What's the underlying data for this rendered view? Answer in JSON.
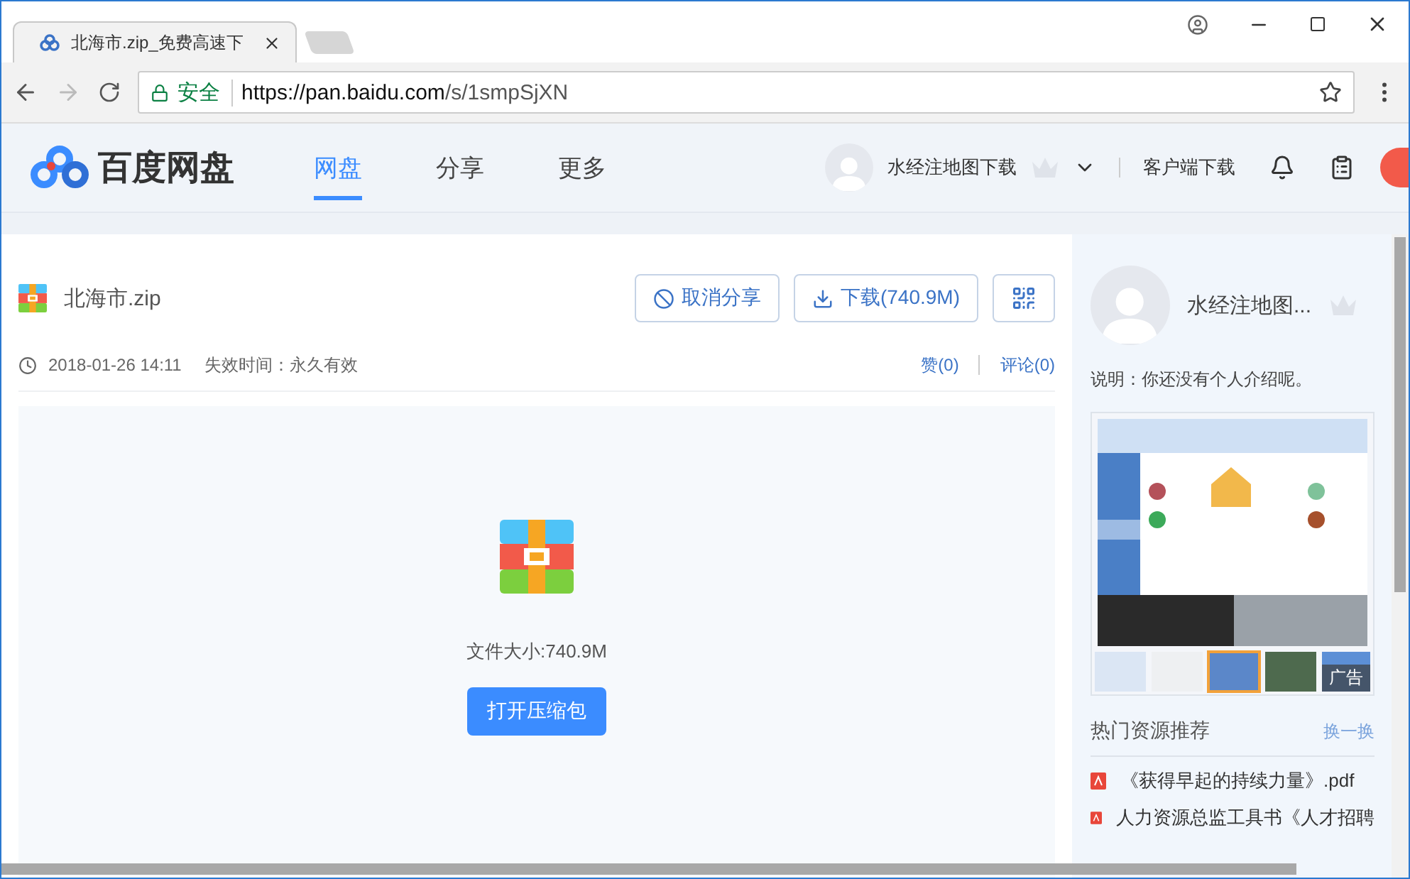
{
  "browser": {
    "tab": {
      "title": "北海市.zip_免费高速下"
    },
    "address": {
      "secure_label": "安全",
      "url_host": "https://pan.baidu.com",
      "url_path": "/s/1smpSjXN"
    }
  },
  "header": {
    "logo": "百度网盘",
    "nav": [
      {
        "label": "网盘",
        "selected": true
      },
      {
        "label": "分享",
        "selected": false
      },
      {
        "label": "更多",
        "selected": false
      }
    ],
    "username": "水经注地图下载",
    "client_download": "客户端下载"
  },
  "file": {
    "name": "北海市.zip",
    "buttons": [
      {
        "kind": "cancel",
        "label": "取消分享"
      },
      {
        "kind": "download",
        "label": "下载(740.9M)"
      },
      {
        "kind": "qr"
      }
    ],
    "date": "2018-01-26 14:11",
    "expiry": "失效时间：永久有效",
    "likes": "赞(0)",
    "comments": "评论(0)",
    "size": "文件大小:740.9M",
    "open_button": "打开压缩包"
  },
  "sidebar": {
    "username": "水经注地图...",
    "description": "说明：你还没有个人介绍呢。",
    "ad": {
      "kind": "picture",
      "label": "广告"
    },
    "hot": {
      "title": "热门资源推荐",
      "refresh": "换一换",
      "items": [
        "《获得早起的持续力量》.pdf",
        "人力资源总监工具书《人才招聘"
      ]
    }
  }
}
